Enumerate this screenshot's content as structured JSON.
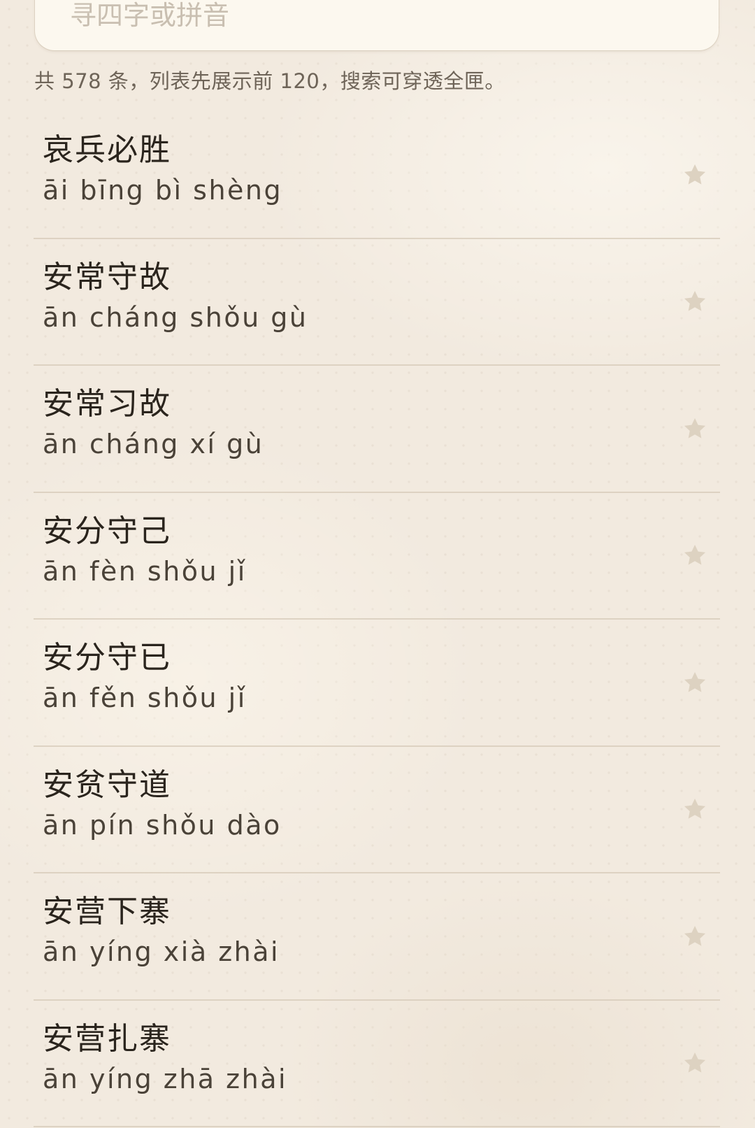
{
  "search": {
    "placeholder": "寻四字或拼音"
  },
  "summary": "共 578 条，列表先展示前 120，搜索可穿透全匣。",
  "icons": {
    "favorite": "star-icon"
  },
  "colors": {
    "star": "#ddd2c1",
    "background": "#f2eadf"
  },
  "idioms": [
    {
      "word": "哀兵必胜",
      "pinyin": "āi bīng bì shèng"
    },
    {
      "word": "安常守故",
      "pinyin": "ān cháng shǒu gù"
    },
    {
      "word": "安常习故",
      "pinyin": "ān cháng xí gù"
    },
    {
      "word": "安分守己",
      "pinyin": "ān fèn shǒu jǐ"
    },
    {
      "word": "安分守已",
      "pinyin": "ān fěn shǒu jǐ"
    },
    {
      "word": "安贫守道",
      "pinyin": "ān pín shǒu dào"
    },
    {
      "word": "安营下寨",
      "pinyin": "ān yíng xià zhài"
    },
    {
      "word": "安营扎寨",
      "pinyin": "ān yíng zhā zhài"
    }
  ]
}
